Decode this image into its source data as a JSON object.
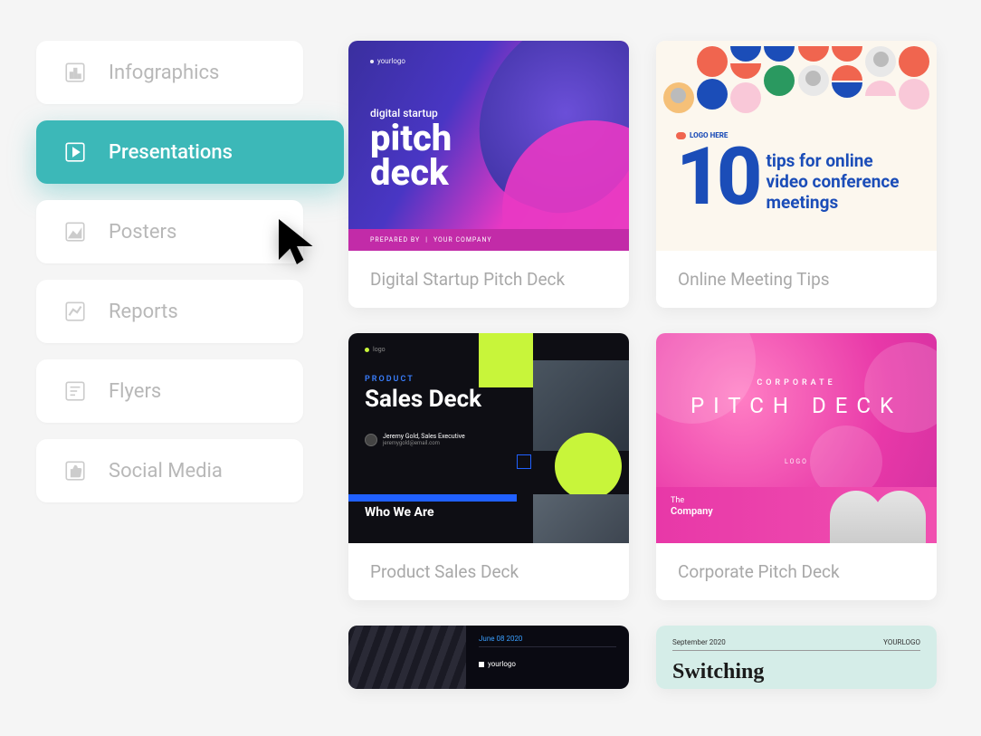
{
  "sidebar": {
    "items": [
      {
        "label": "Infographics",
        "icon": "bar-chart-icon",
        "active": false
      },
      {
        "label": "Presentations",
        "icon": "presentation-icon",
        "active": true
      },
      {
        "label": "Posters",
        "icon": "image-icon",
        "active": false
      },
      {
        "label": "Reports",
        "icon": "line-chart-icon",
        "active": false
      },
      {
        "label": "Flyers",
        "icon": "document-icon",
        "active": false
      },
      {
        "label": "Social Media",
        "icon": "thumbs-up-icon",
        "active": false
      }
    ]
  },
  "templates": [
    {
      "caption": "Digital Startup Pitch Deck",
      "preview": {
        "logo": "yourlogo",
        "subtitle": "digital startup",
        "title_line1": "pitch",
        "title_line2": "deck",
        "footer_prefix": "PREPARED BY",
        "footer_company": "YOUR COMPANY"
      }
    },
    {
      "caption": "Online Meeting Tips",
      "preview": {
        "logo": "LOGO HERE",
        "number": "10",
        "text": "tips for online video conference meetings"
      }
    },
    {
      "caption": "Product Sales Deck",
      "preview": {
        "logo": "logo",
        "kicker": "PRODUCT",
        "title": "Sales Deck",
        "author_name": "Jeremy Gold, Sales Executive",
        "author_email": "jeremygold@email.com",
        "section": "Who We Are"
      }
    },
    {
      "caption": "Corporate Pitch Deck",
      "preview": {
        "kicker": "CORPORATE",
        "title": "PITCH DECK",
        "logo": "LOGO",
        "company_label": "The",
        "company_name": "Company"
      }
    },
    {
      "preview": {
        "date": "June 08 2020",
        "logo": "yourlogo"
      }
    },
    {
      "preview": {
        "date": "September 2020",
        "logo": "YOURLOGO",
        "title": "Switching"
      }
    }
  ],
  "colors": {
    "accent": "#3cb8b8",
    "muted": "#b8b8b8"
  }
}
